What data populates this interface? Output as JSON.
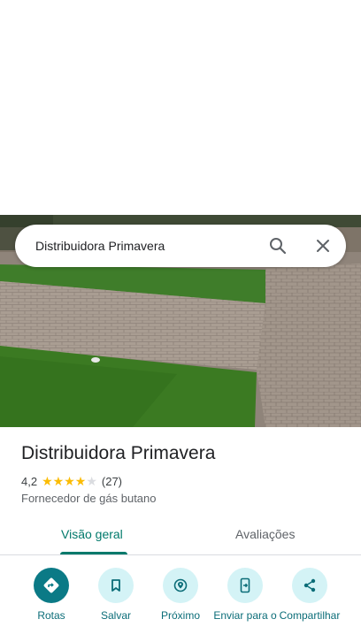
{
  "search": {
    "query": "Distribuidora Primavera"
  },
  "place": {
    "name": "Distribuidora Primavera",
    "rating": "4,2",
    "stars": {
      "full": 4,
      "empty": 1,
      "value": 4.2
    },
    "review_count": "(27)",
    "category": "Fornecedor de gás butano"
  },
  "tabs": [
    {
      "label": "Visão geral",
      "active": true
    },
    {
      "label": "Avaliações",
      "active": false
    }
  ],
  "actions": [
    {
      "label": "Rotas",
      "icon": "directions-icon"
    },
    {
      "label": "Salvar",
      "icon": "bookmark-icon"
    },
    {
      "label": "Próximo",
      "icon": "nearby-icon"
    },
    {
      "label": "Enviar para o",
      "icon": "send-to-phone-icon"
    },
    {
      "label": "Compartilhar",
      "icon": "share-icon"
    }
  ],
  "colors": {
    "accent": "#00796b",
    "primary_action": "#0b7a86",
    "action_bg": "#d4f3f6",
    "star": "#fbbc04"
  }
}
